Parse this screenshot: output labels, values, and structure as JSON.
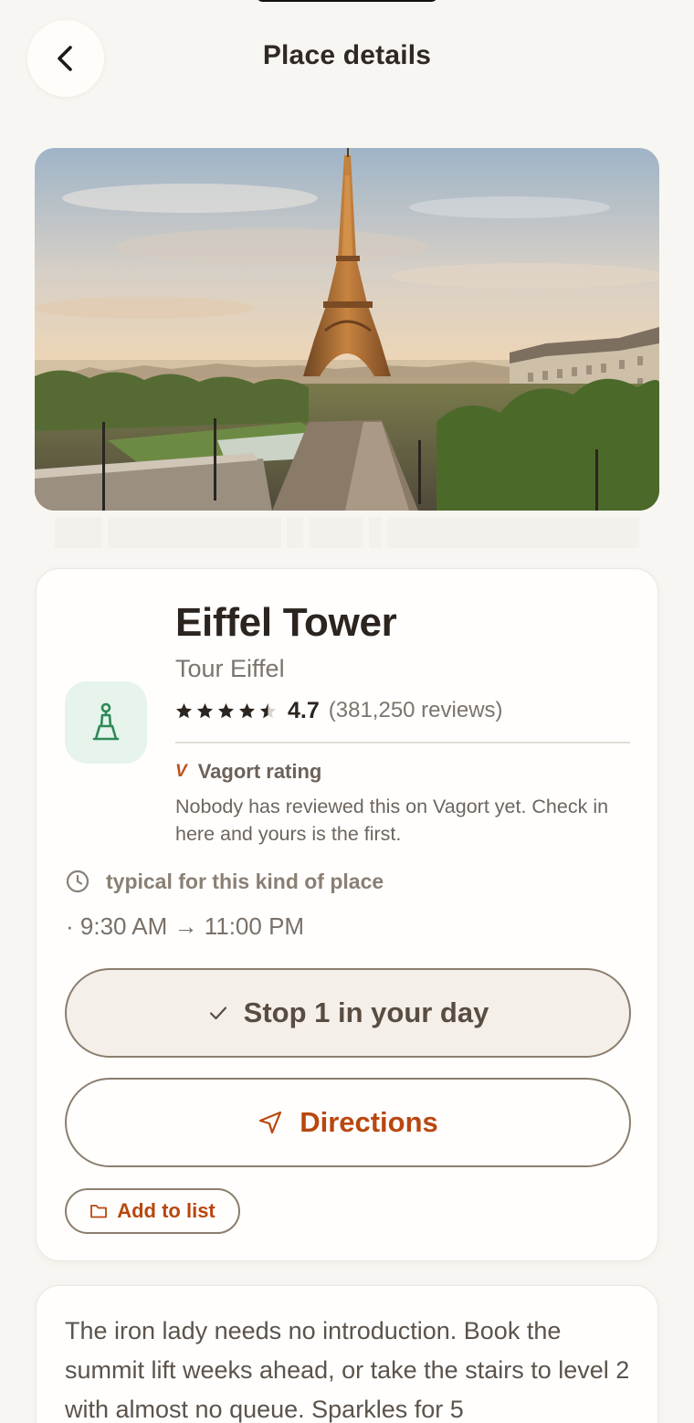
{
  "header": {
    "title": "Place details"
  },
  "place": {
    "name": "Eiffel Tower",
    "local_name": "Tour Eiffel",
    "rating": {
      "value": "4.7",
      "stars": 4.7,
      "reviews": "(381,250 reviews)"
    },
    "category_icon": "monument-icon"
  },
  "vagort": {
    "mark": "V",
    "label": "Vagort rating",
    "note": "Nobody has reviewed this on Vagort yet. Check in here and yours is the first."
  },
  "hours": {
    "label": "typical for this kind of place",
    "range": "· 9:30 AM → 11:00 PM"
  },
  "actions": {
    "stop_label": "Stop 1 in your day",
    "directions_label": "Directions",
    "add_to_list_label": "Add to list"
  },
  "description": {
    "text": "The iron lady needs no introduction. Book the summit lift weeks ahead, or take the stairs to level 2 with almost no queue. Sparkles for 5"
  },
  "colors": {
    "background": "#f8f6f2",
    "accent": "#b9470e",
    "icon_green": "#2e8a57",
    "icon_bg": "#e6f4ec",
    "outline": "#8b7d6d"
  }
}
